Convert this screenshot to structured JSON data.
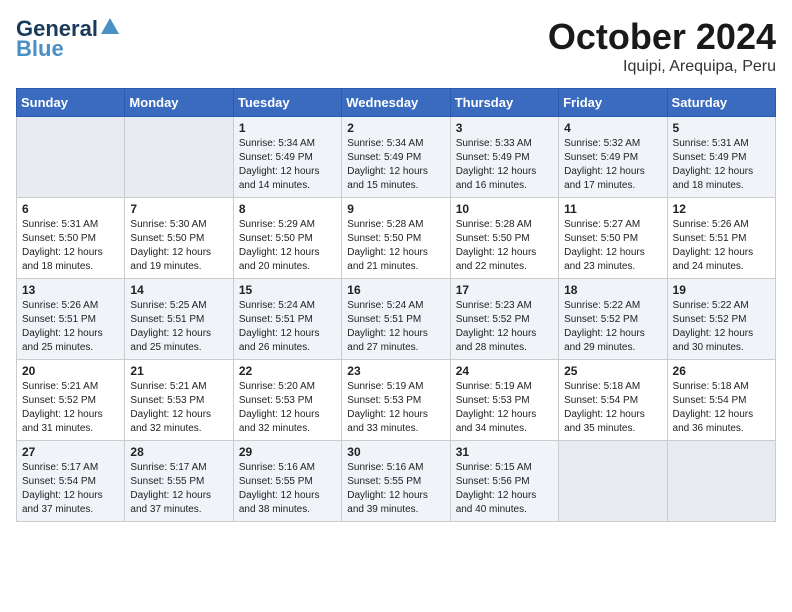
{
  "header": {
    "logo_general": "General",
    "logo_blue": "Blue",
    "month_title": "October 2024",
    "location": "Iquipi, Arequipa, Peru"
  },
  "weekdays": [
    "Sunday",
    "Monday",
    "Tuesday",
    "Wednesday",
    "Thursday",
    "Friday",
    "Saturday"
  ],
  "weeks": [
    [
      {
        "day": "",
        "sunrise": "",
        "sunset": "",
        "daylight": ""
      },
      {
        "day": "",
        "sunrise": "",
        "sunset": "",
        "daylight": ""
      },
      {
        "day": "1",
        "sunrise": "Sunrise: 5:34 AM",
        "sunset": "Sunset: 5:49 PM",
        "daylight": "Daylight: 12 hours and 14 minutes."
      },
      {
        "day": "2",
        "sunrise": "Sunrise: 5:34 AM",
        "sunset": "Sunset: 5:49 PM",
        "daylight": "Daylight: 12 hours and 15 minutes."
      },
      {
        "day": "3",
        "sunrise": "Sunrise: 5:33 AM",
        "sunset": "Sunset: 5:49 PM",
        "daylight": "Daylight: 12 hours and 16 minutes."
      },
      {
        "day": "4",
        "sunrise": "Sunrise: 5:32 AM",
        "sunset": "Sunset: 5:49 PM",
        "daylight": "Daylight: 12 hours and 17 minutes."
      },
      {
        "day": "5",
        "sunrise": "Sunrise: 5:31 AM",
        "sunset": "Sunset: 5:49 PM",
        "daylight": "Daylight: 12 hours and 18 minutes."
      }
    ],
    [
      {
        "day": "6",
        "sunrise": "Sunrise: 5:31 AM",
        "sunset": "Sunset: 5:50 PM",
        "daylight": "Daylight: 12 hours and 18 minutes."
      },
      {
        "day": "7",
        "sunrise": "Sunrise: 5:30 AM",
        "sunset": "Sunset: 5:50 PM",
        "daylight": "Daylight: 12 hours and 19 minutes."
      },
      {
        "day": "8",
        "sunrise": "Sunrise: 5:29 AM",
        "sunset": "Sunset: 5:50 PM",
        "daylight": "Daylight: 12 hours and 20 minutes."
      },
      {
        "day": "9",
        "sunrise": "Sunrise: 5:28 AM",
        "sunset": "Sunset: 5:50 PM",
        "daylight": "Daylight: 12 hours and 21 minutes."
      },
      {
        "day": "10",
        "sunrise": "Sunrise: 5:28 AM",
        "sunset": "Sunset: 5:50 PM",
        "daylight": "Daylight: 12 hours and 22 minutes."
      },
      {
        "day": "11",
        "sunrise": "Sunrise: 5:27 AM",
        "sunset": "Sunset: 5:50 PM",
        "daylight": "Daylight: 12 hours and 23 minutes."
      },
      {
        "day": "12",
        "sunrise": "Sunrise: 5:26 AM",
        "sunset": "Sunset: 5:51 PM",
        "daylight": "Daylight: 12 hours and 24 minutes."
      }
    ],
    [
      {
        "day": "13",
        "sunrise": "Sunrise: 5:26 AM",
        "sunset": "Sunset: 5:51 PM",
        "daylight": "Daylight: 12 hours and 25 minutes."
      },
      {
        "day": "14",
        "sunrise": "Sunrise: 5:25 AM",
        "sunset": "Sunset: 5:51 PM",
        "daylight": "Daylight: 12 hours and 25 minutes."
      },
      {
        "day": "15",
        "sunrise": "Sunrise: 5:24 AM",
        "sunset": "Sunset: 5:51 PM",
        "daylight": "Daylight: 12 hours and 26 minutes."
      },
      {
        "day": "16",
        "sunrise": "Sunrise: 5:24 AM",
        "sunset": "Sunset: 5:51 PM",
        "daylight": "Daylight: 12 hours and 27 minutes."
      },
      {
        "day": "17",
        "sunrise": "Sunrise: 5:23 AM",
        "sunset": "Sunset: 5:52 PM",
        "daylight": "Daylight: 12 hours and 28 minutes."
      },
      {
        "day": "18",
        "sunrise": "Sunrise: 5:22 AM",
        "sunset": "Sunset: 5:52 PM",
        "daylight": "Daylight: 12 hours and 29 minutes."
      },
      {
        "day": "19",
        "sunrise": "Sunrise: 5:22 AM",
        "sunset": "Sunset: 5:52 PM",
        "daylight": "Daylight: 12 hours and 30 minutes."
      }
    ],
    [
      {
        "day": "20",
        "sunrise": "Sunrise: 5:21 AM",
        "sunset": "Sunset: 5:52 PM",
        "daylight": "Daylight: 12 hours and 31 minutes."
      },
      {
        "day": "21",
        "sunrise": "Sunrise: 5:21 AM",
        "sunset": "Sunset: 5:53 PM",
        "daylight": "Daylight: 12 hours and 32 minutes."
      },
      {
        "day": "22",
        "sunrise": "Sunrise: 5:20 AM",
        "sunset": "Sunset: 5:53 PM",
        "daylight": "Daylight: 12 hours and 32 minutes."
      },
      {
        "day": "23",
        "sunrise": "Sunrise: 5:19 AM",
        "sunset": "Sunset: 5:53 PM",
        "daylight": "Daylight: 12 hours and 33 minutes."
      },
      {
        "day": "24",
        "sunrise": "Sunrise: 5:19 AM",
        "sunset": "Sunset: 5:53 PM",
        "daylight": "Daylight: 12 hours and 34 minutes."
      },
      {
        "day": "25",
        "sunrise": "Sunrise: 5:18 AM",
        "sunset": "Sunset: 5:54 PM",
        "daylight": "Daylight: 12 hours and 35 minutes."
      },
      {
        "day": "26",
        "sunrise": "Sunrise: 5:18 AM",
        "sunset": "Sunset: 5:54 PM",
        "daylight": "Daylight: 12 hours and 36 minutes."
      }
    ],
    [
      {
        "day": "27",
        "sunrise": "Sunrise: 5:17 AM",
        "sunset": "Sunset: 5:54 PM",
        "daylight": "Daylight: 12 hours and 37 minutes."
      },
      {
        "day": "28",
        "sunrise": "Sunrise: 5:17 AM",
        "sunset": "Sunset: 5:55 PM",
        "daylight": "Daylight: 12 hours and 37 minutes."
      },
      {
        "day": "29",
        "sunrise": "Sunrise: 5:16 AM",
        "sunset": "Sunset: 5:55 PM",
        "daylight": "Daylight: 12 hours and 38 minutes."
      },
      {
        "day": "30",
        "sunrise": "Sunrise: 5:16 AM",
        "sunset": "Sunset: 5:55 PM",
        "daylight": "Daylight: 12 hours and 39 minutes."
      },
      {
        "day": "31",
        "sunrise": "Sunrise: 5:15 AM",
        "sunset": "Sunset: 5:56 PM",
        "daylight": "Daylight: 12 hours and 40 minutes."
      },
      {
        "day": "",
        "sunrise": "",
        "sunset": "",
        "daylight": ""
      },
      {
        "day": "",
        "sunrise": "",
        "sunset": "",
        "daylight": ""
      }
    ]
  ]
}
